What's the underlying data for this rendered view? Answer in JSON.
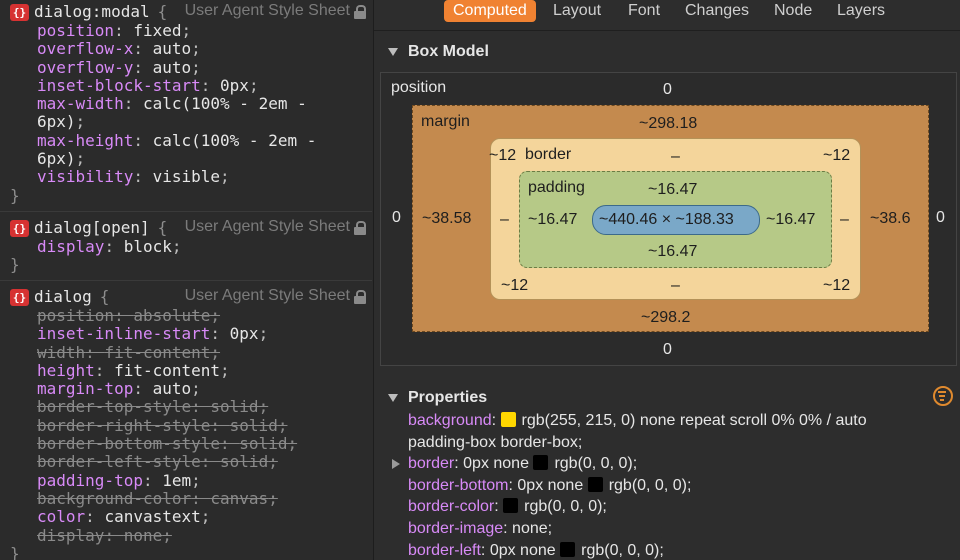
{
  "rules": [
    {
      "selector": "dialog:modal",
      "origin": "User Agent Style Sheet",
      "declarations": [
        {
          "prop": "position",
          "val": "fixed",
          "overridden": false
        },
        {
          "prop": "overflow-x",
          "val": "auto",
          "overridden": false
        },
        {
          "prop": "overflow-y",
          "val": "auto",
          "overridden": false
        },
        {
          "prop": "inset-block-start",
          "val": "0px",
          "overridden": false
        },
        {
          "prop": "max-width",
          "val": "calc(100% - 2em -\n6px)",
          "overridden": false
        },
        {
          "prop": "max-height",
          "val": "calc(100% - 2em -\n6px)",
          "overridden": false
        },
        {
          "prop": "visibility",
          "val": "visible",
          "overridden": false
        }
      ]
    },
    {
      "selector": "dialog[open]",
      "origin": "User Agent Style Sheet",
      "declarations": [
        {
          "prop": "display",
          "val": "block",
          "overridden": false
        }
      ]
    },
    {
      "selector": "dialog",
      "origin": "User Agent Style Sheet",
      "declarations": [
        {
          "prop": "position",
          "val": "absolute",
          "overridden": true
        },
        {
          "prop": "inset-inline-start",
          "val": "0px",
          "overridden": false
        },
        {
          "prop": "width",
          "val": "fit-content",
          "overridden": true
        },
        {
          "prop": "height",
          "val": "fit-content",
          "overridden": false
        },
        {
          "prop": "margin-top",
          "val": "auto",
          "overridden": false
        },
        {
          "prop": "border-top-style",
          "val": "solid",
          "overridden": true
        },
        {
          "prop": "border-right-style",
          "val": "solid",
          "overridden": true
        },
        {
          "prop": "border-bottom-style",
          "val": "solid",
          "overridden": true
        },
        {
          "prop": "border-left-style",
          "val": "solid",
          "overridden": true
        },
        {
          "prop": "padding-top",
          "val": "1em",
          "overridden": false
        },
        {
          "prop": "background-color",
          "val": "canvas",
          "overridden": true
        },
        {
          "prop": "color",
          "val": "canvastext",
          "overridden": false
        },
        {
          "prop": "display",
          "val": "none",
          "overridden": true
        }
      ]
    }
  ],
  "tabs": [
    {
      "label": "Computed",
      "active": true
    },
    {
      "label": "Layout",
      "active": false
    },
    {
      "label": "Font",
      "active": false
    },
    {
      "label": "Changes",
      "active": false
    },
    {
      "label": "Node",
      "active": false
    },
    {
      "label": "Layers",
      "active": false
    }
  ],
  "box_model": {
    "title": "Box Model",
    "position_label": "position",
    "position": {
      "top": "0",
      "left": "0",
      "right": "0",
      "bottom": "0"
    },
    "margin_label": "margin",
    "margin": {
      "top": "~298.18",
      "left": "~38.58",
      "right": "~38.6",
      "bottom": "~298.2"
    },
    "border_label": "border",
    "border": {
      "top": "–",
      "left": "–",
      "right": "–",
      "bottom": "–"
    },
    "border_corners": {
      "top_left": "~12",
      "top_right": "~12",
      "bottom_left": "~12",
      "bottom_right": "~12"
    },
    "padding_label": "padding",
    "padding": {
      "top": "~16.47",
      "left": "~16.47",
      "right": "~16.47",
      "bottom": "~16.47"
    },
    "content": "~440.46 × ~188.33"
  },
  "properties": {
    "title": "Properties",
    "rows": [
      {
        "name": "background",
        "swatch": "#ffd700",
        "value": "rgb(255, 215, 0) none repeat scroll 0% 0% / auto",
        "value2": "padding-box border-box;",
        "expandable": false
      },
      {
        "name": "border",
        "swatch": "#000000",
        "value": "0px none",
        "value_after": "rgb(0, 0, 0);",
        "expandable": true
      },
      {
        "name": "border-bottom",
        "swatch": "#000000",
        "value": "0px none",
        "value_after": "rgb(0, 0, 0);",
        "expandable": false
      },
      {
        "name": "border-color",
        "swatch": "#000000",
        "value": "",
        "value_after": "rgb(0, 0, 0);",
        "expandable": false
      },
      {
        "name": "border-image",
        "swatch": "",
        "value": "none;",
        "value_after": "",
        "expandable": false
      },
      {
        "name": "border-left",
        "swatch": "#000000",
        "value": "0px none",
        "value_after": "rgb(0, 0, 0);",
        "expandable": false
      }
    ]
  },
  "colors": {
    "accent": "#f08232",
    "property": "#d88af7"
  }
}
